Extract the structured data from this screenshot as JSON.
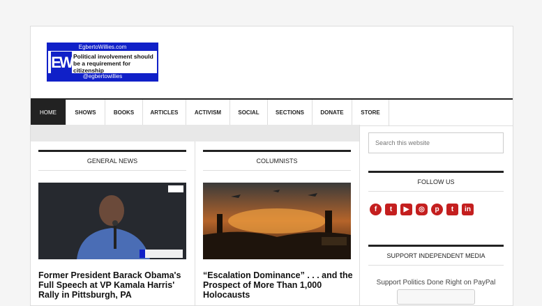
{
  "header": {
    "logo_top": "EgbertoWillies.com",
    "logo_mark": "EW",
    "logo_tagline": "Political involvement should be a requirement for citizenship",
    "logo_bottom": "@egbertowillies"
  },
  "nav": {
    "items": [
      "HOME",
      "SHOWS",
      "BOOKS",
      "ARTICLES",
      "ACTIVISM",
      "SOCIAL",
      "SECTIONS",
      "DONATE",
      "STORE"
    ]
  },
  "sections": {
    "left_heading": "GENERAL NEWS",
    "right_heading": "COLUMNISTS"
  },
  "posts": {
    "left_title": "Former President Barack Obama's Full Speech at VP Kamala Harris' Rally in Pittsburgh, PA",
    "right_title": "“Escalation Dominance” . . . and the Prospect of More Than 1,000 Holocausts"
  },
  "sidebar": {
    "search_placeholder": "Search this website",
    "follow_heading": "FOLLOW US",
    "social_icons": [
      "facebook-icon",
      "twitter-icon",
      "youtube-icon",
      "instagram-icon",
      "pinterest-icon",
      "tumblr-icon",
      "linkedin-icon"
    ],
    "support_heading": "SUPPORT INDEPENDENT MEDIA",
    "support_text": "Support Politics Done Right on PayPal"
  },
  "colors": {
    "brand_blue": "#1020c8",
    "nav_active": "#222222",
    "social_red": "#c41f1f"
  }
}
